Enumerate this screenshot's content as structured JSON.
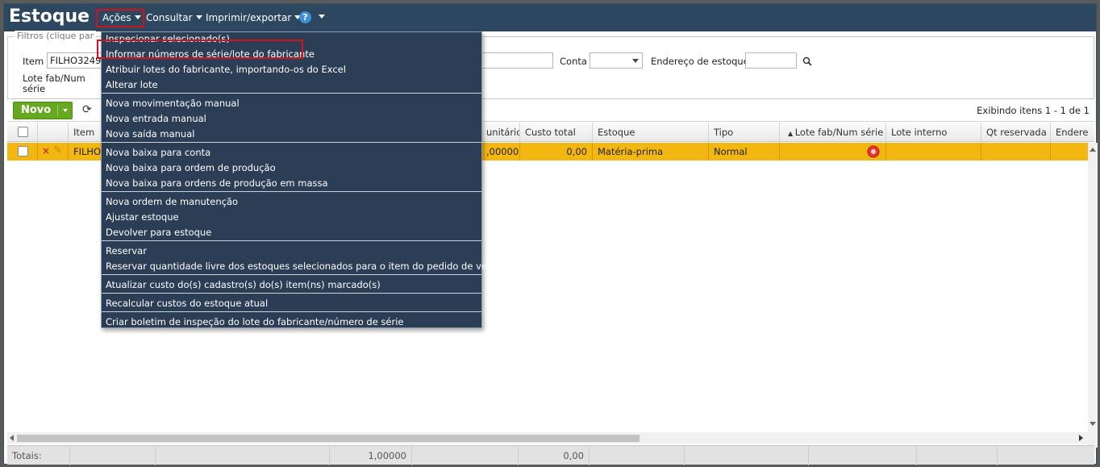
{
  "app": {
    "title": "Estoque"
  },
  "menubar": {
    "acoes": "Ações",
    "consultar": "Consultar",
    "imprimir": "Imprimir/exportar",
    "help": "?"
  },
  "filters": {
    "legend": "Filtros (clique par",
    "item_label": "Item",
    "item_value": "FILHO3249",
    "lote_label_1": "Lote fab/Num",
    "lote_label_2": "série",
    "conta_label": "Conta",
    "endereco_label": "Endereço de estoque"
  },
  "toolbar": {
    "novo": "Novo",
    "count": "Exibindo itens 1 - 1 de 1"
  },
  "grid": {
    "headers": {
      "item": "Item",
      "unitario": "unitário",
      "custo_total": "Custo total",
      "estoque": "Estoque",
      "tipo": "Tipo",
      "lote": "Lote fab/Num série",
      "lote_interno": "Lote interno",
      "qt_reservada": "Qt reservada",
      "endereco": "Endere"
    },
    "row": {
      "item": "FILHO",
      "unitario": ",00000",
      "custo_total": "0,00",
      "estoque": "Matéria-prima",
      "tipo": "Normal"
    }
  },
  "footer": {
    "totais": "Totais:",
    "qtd": "1,00000",
    "custo": "0,00"
  },
  "dropdown": {
    "items": [
      "Inspecionar selecionado(s)",
      "Informar números de série/lote do fabricante",
      "Atribuir lotes do fabricante, importando-os do Excel",
      "Alterar lote",
      "Nova movimentação manual",
      "Nova entrada manual",
      "Nova saída manual",
      "Nova baixa para conta",
      "Nova baixa para ordem de produção",
      "Nova baixa para ordens de produção em massa",
      "Nova ordem de manutenção",
      "Ajustar estoque",
      "Devolver para estoque",
      "Reservar",
      "Reservar quantidade livre dos estoques selecionados para o item do pedido de venda",
      "Atualizar custo do(s) cadastro(s) do(s) item(ns) marcado(s)",
      "Recalcular custos do estoque atual",
      "Criar boletim de inspeção do lote do fabricante/número de série"
    ]
  },
  "colors": {
    "titlebar": "#2e4761",
    "selected_row": "#f4b610",
    "menu_bg": "#2c3e55",
    "highlight": "#d0121b",
    "novo": "#66a821"
  }
}
